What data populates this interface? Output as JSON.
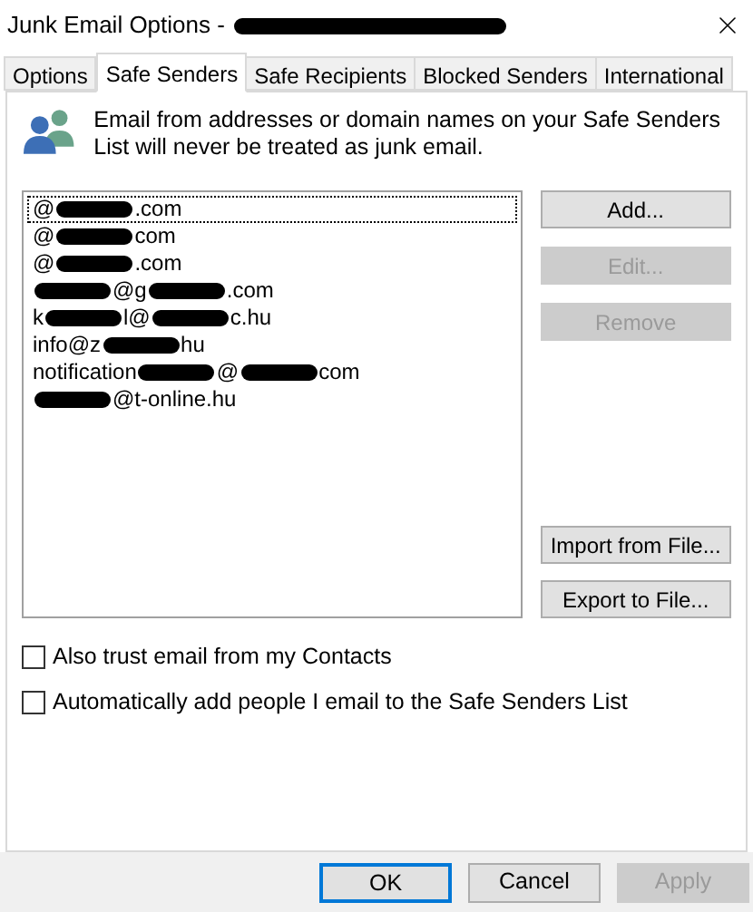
{
  "window": {
    "title": [
      {
        "kind": "text",
        "text": "Junk Email Options -"
      },
      {
        "kind": "redacted"
      }
    ]
  },
  "tabs": [
    {
      "label": "Options",
      "selected": false
    },
    {
      "label": "Safe Senders",
      "selected": true
    },
    {
      "label": "Safe Recipients",
      "selected": false
    },
    {
      "label": "Blocked Senders",
      "selected": false
    },
    {
      "label": "International",
      "selected": false
    }
  ],
  "info": "Email from addresses or domain names on your Safe Senders List will never be treated as junk email.",
  "senders": [
    {
      "selected": true,
      "parts": [
        {
          "kind": "text",
          "text": "@"
        },
        {
          "kind": "redacted"
        },
        {
          "kind": "text",
          "text": ".com"
        }
      ]
    },
    {
      "selected": false,
      "parts": [
        {
          "kind": "text",
          "text": "@"
        },
        {
          "kind": "redacted"
        },
        {
          "kind": "text",
          "text": "com"
        }
      ]
    },
    {
      "selected": false,
      "parts": [
        {
          "kind": "text",
          "text": "@"
        },
        {
          "kind": "redacted"
        },
        {
          "kind": "text",
          "text": ".com"
        }
      ]
    },
    {
      "selected": false,
      "parts": [
        {
          "kind": "redacted"
        },
        {
          "kind": "text",
          "text": "@g"
        },
        {
          "kind": "redacted"
        },
        {
          "kind": "text",
          "text": ".com"
        }
      ]
    },
    {
      "selected": false,
      "parts": [
        {
          "kind": "text",
          "text": "k"
        },
        {
          "kind": "redacted"
        },
        {
          "kind": "text",
          "text": "l@"
        },
        {
          "kind": "redacted"
        },
        {
          "kind": "text",
          "text": "c.hu"
        }
      ]
    },
    {
      "selected": false,
      "parts": [
        {
          "kind": "text",
          "text": "info@z"
        },
        {
          "kind": "redacted"
        },
        {
          "kind": "text",
          "text": "hu"
        }
      ]
    },
    {
      "selected": false,
      "parts": [
        {
          "kind": "text",
          "text": "notification"
        },
        {
          "kind": "redacted"
        },
        {
          "kind": "text",
          "text": "@"
        },
        {
          "kind": "redacted"
        },
        {
          "kind": "text",
          "text": "com"
        }
      ]
    },
    {
      "selected": false,
      "parts": [
        {
          "kind": "redacted"
        },
        {
          "kind": "text",
          "text": "@t-online.hu"
        }
      ]
    }
  ],
  "side_buttons": [
    {
      "label": "Add...",
      "disabled": false
    },
    {
      "label": "Edit...",
      "disabled": true
    },
    {
      "label": "Remove",
      "disabled": true
    }
  ],
  "file_buttons": [
    {
      "label": "Import from File...",
      "disabled": false
    },
    {
      "label": "Export to File...",
      "disabled": false
    }
  ],
  "options": [
    {
      "label": "Also trust email from my Contacts",
      "checked": false
    },
    {
      "label": "Automatically add people I email to the Safe Senders List",
      "checked": false
    }
  ],
  "footer_buttons": [
    {
      "label": "OK",
      "disabled": false,
      "default": true
    },
    {
      "label": "Cancel",
      "disabled": false,
      "default": false
    },
    {
      "label": "Apply",
      "disabled": true,
      "default": false
    }
  ]
}
